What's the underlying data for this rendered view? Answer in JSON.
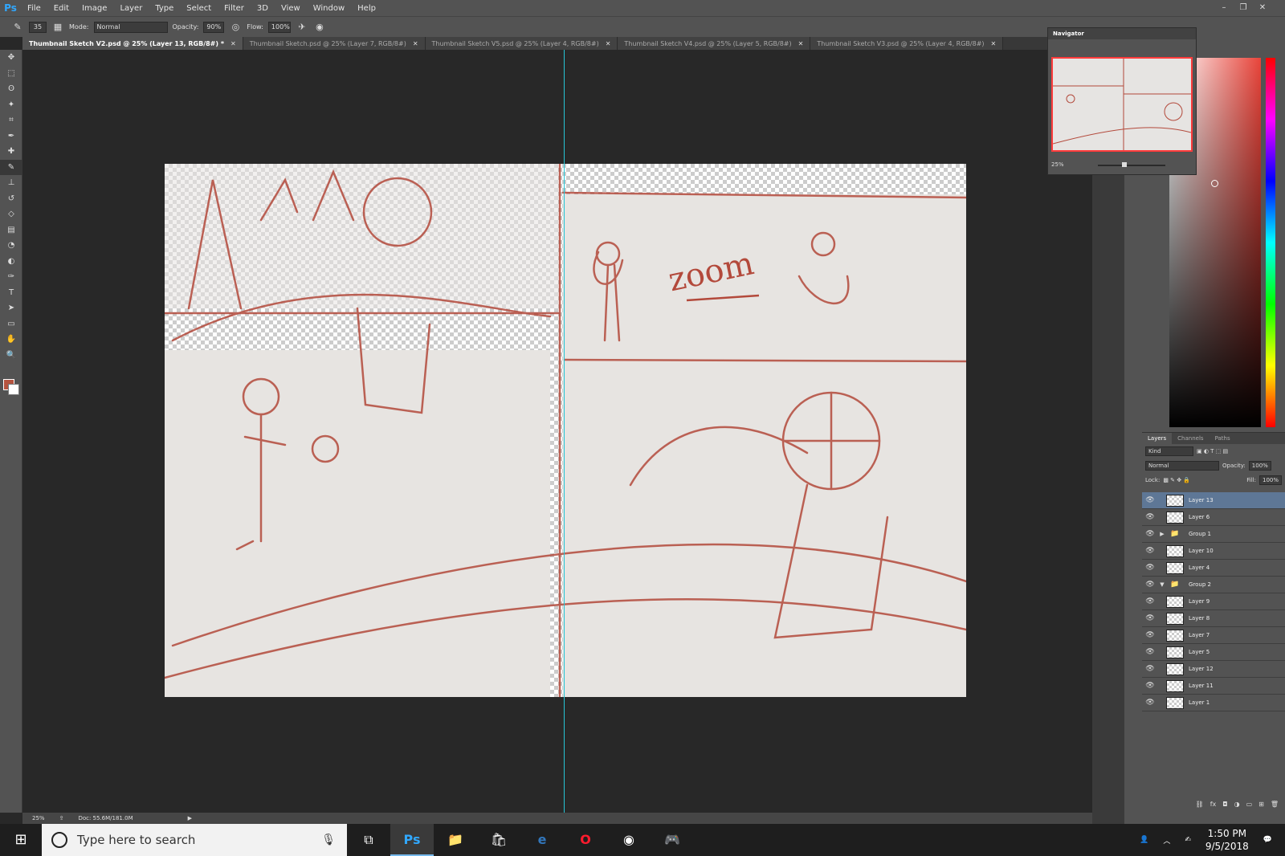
{
  "menubar": {
    "logo": "Ps",
    "items": [
      "File",
      "Edit",
      "Image",
      "Layer",
      "Type",
      "Select",
      "Filter",
      "3D",
      "View",
      "Window",
      "Help"
    ],
    "window_controls": [
      "–",
      "❐",
      "✕"
    ]
  },
  "options": {
    "brush_size": "35",
    "mode_label": "Mode:",
    "mode_value": "Normal",
    "opacity_label": "Opacity:",
    "opacity_value": "90%",
    "flow_label": "Flow:",
    "flow_value": "100%"
  },
  "tabs": [
    {
      "label": "Thumbnail Sketch V2.psd @ 25% (Layer 13, RGB/8#) *",
      "active": true
    },
    {
      "label": "Thumbnail Sketch.psd @ 25% (Layer 7, RGB/8#)",
      "active": false
    },
    {
      "label": "Thumbnail Sketch V5.psd @ 25% (Layer 4, RGB/8#)",
      "active": false
    },
    {
      "label": "Thumbnail Sketch V4.psd @ 25% (Layer 5, RGB/8#)",
      "active": false
    },
    {
      "label": "Thumbnail Sketch V3.psd @ 25% (Layer 4, RGB/8#)",
      "active": false
    }
  ],
  "tools": [
    "move-tool-icon",
    "marquee-tool-icon",
    "lasso-tool-icon",
    "quick-select-tool-icon",
    "crop-tool-icon",
    "eyedropper-tool-icon",
    "healing-brush-tool-icon",
    "brush-tool-icon",
    "clone-stamp-tool-icon",
    "history-brush-tool-icon",
    "eraser-tool-icon",
    "gradient-tool-icon",
    "blur-tool-icon",
    "dodge-tool-icon",
    "pen-tool-icon",
    "type-tool-icon",
    "path-select-tool-icon",
    "shape-tool-icon",
    "hand-tool-icon",
    "zoom-tool-icon"
  ],
  "colors": {
    "foreground": "#b5543f",
    "background": "#ffffff",
    "sketch_stroke": "#b3493b",
    "guide": "#27c5d6",
    "selected_layer": "#5e7796"
  },
  "canvas": {
    "sketch_text": "zoom"
  },
  "status": {
    "zoom": "25%",
    "doc_info": "Doc: 55.6M/181.0M"
  },
  "navigator": {
    "title": "Navigator",
    "zoom": "25%"
  },
  "layers_panel": {
    "tabs": [
      "Layers",
      "Channels",
      "Paths"
    ],
    "kind_label": "Kind",
    "blend_mode": "Normal",
    "opacity_label": "Opacity:",
    "opacity_value": "100%",
    "lock_label": "Lock:",
    "fill_label": "Fill:",
    "fill_value": "100%",
    "layers": [
      {
        "name": "Layer 13",
        "type": "layer",
        "selected": true
      },
      {
        "name": "Layer 6",
        "type": "layer",
        "selected": false
      },
      {
        "name": "Group 1",
        "type": "group",
        "expanded": false,
        "selected": false
      },
      {
        "name": "Layer 10",
        "type": "layer",
        "selected": false
      },
      {
        "name": "Layer 4",
        "type": "layer",
        "selected": false
      },
      {
        "name": "Group 2",
        "type": "group",
        "expanded": true,
        "selected": false
      },
      {
        "name": "Layer 9",
        "type": "layer",
        "selected": false
      },
      {
        "name": "Layer 8",
        "type": "layer",
        "selected": false
      },
      {
        "name": "Layer 7",
        "type": "layer",
        "selected": false
      },
      {
        "name": "Layer 5",
        "type": "layer",
        "selected": false
      },
      {
        "name": "Layer 12",
        "type": "layer",
        "selected": false
      },
      {
        "name": "Layer 11",
        "type": "layer",
        "selected": false
      },
      {
        "name": "Layer 1",
        "type": "layer",
        "selected": false
      }
    ]
  },
  "taskbar": {
    "search_placeholder": "Type here to search",
    "apps": [
      "task-view-icon",
      "photoshop-icon",
      "file-explorer-icon",
      "store-icon",
      "edge-icon",
      "opera-icon",
      "chrome-icon",
      "discord-icon"
    ],
    "time": "1:50 PM",
    "date": "9/5/2018"
  }
}
